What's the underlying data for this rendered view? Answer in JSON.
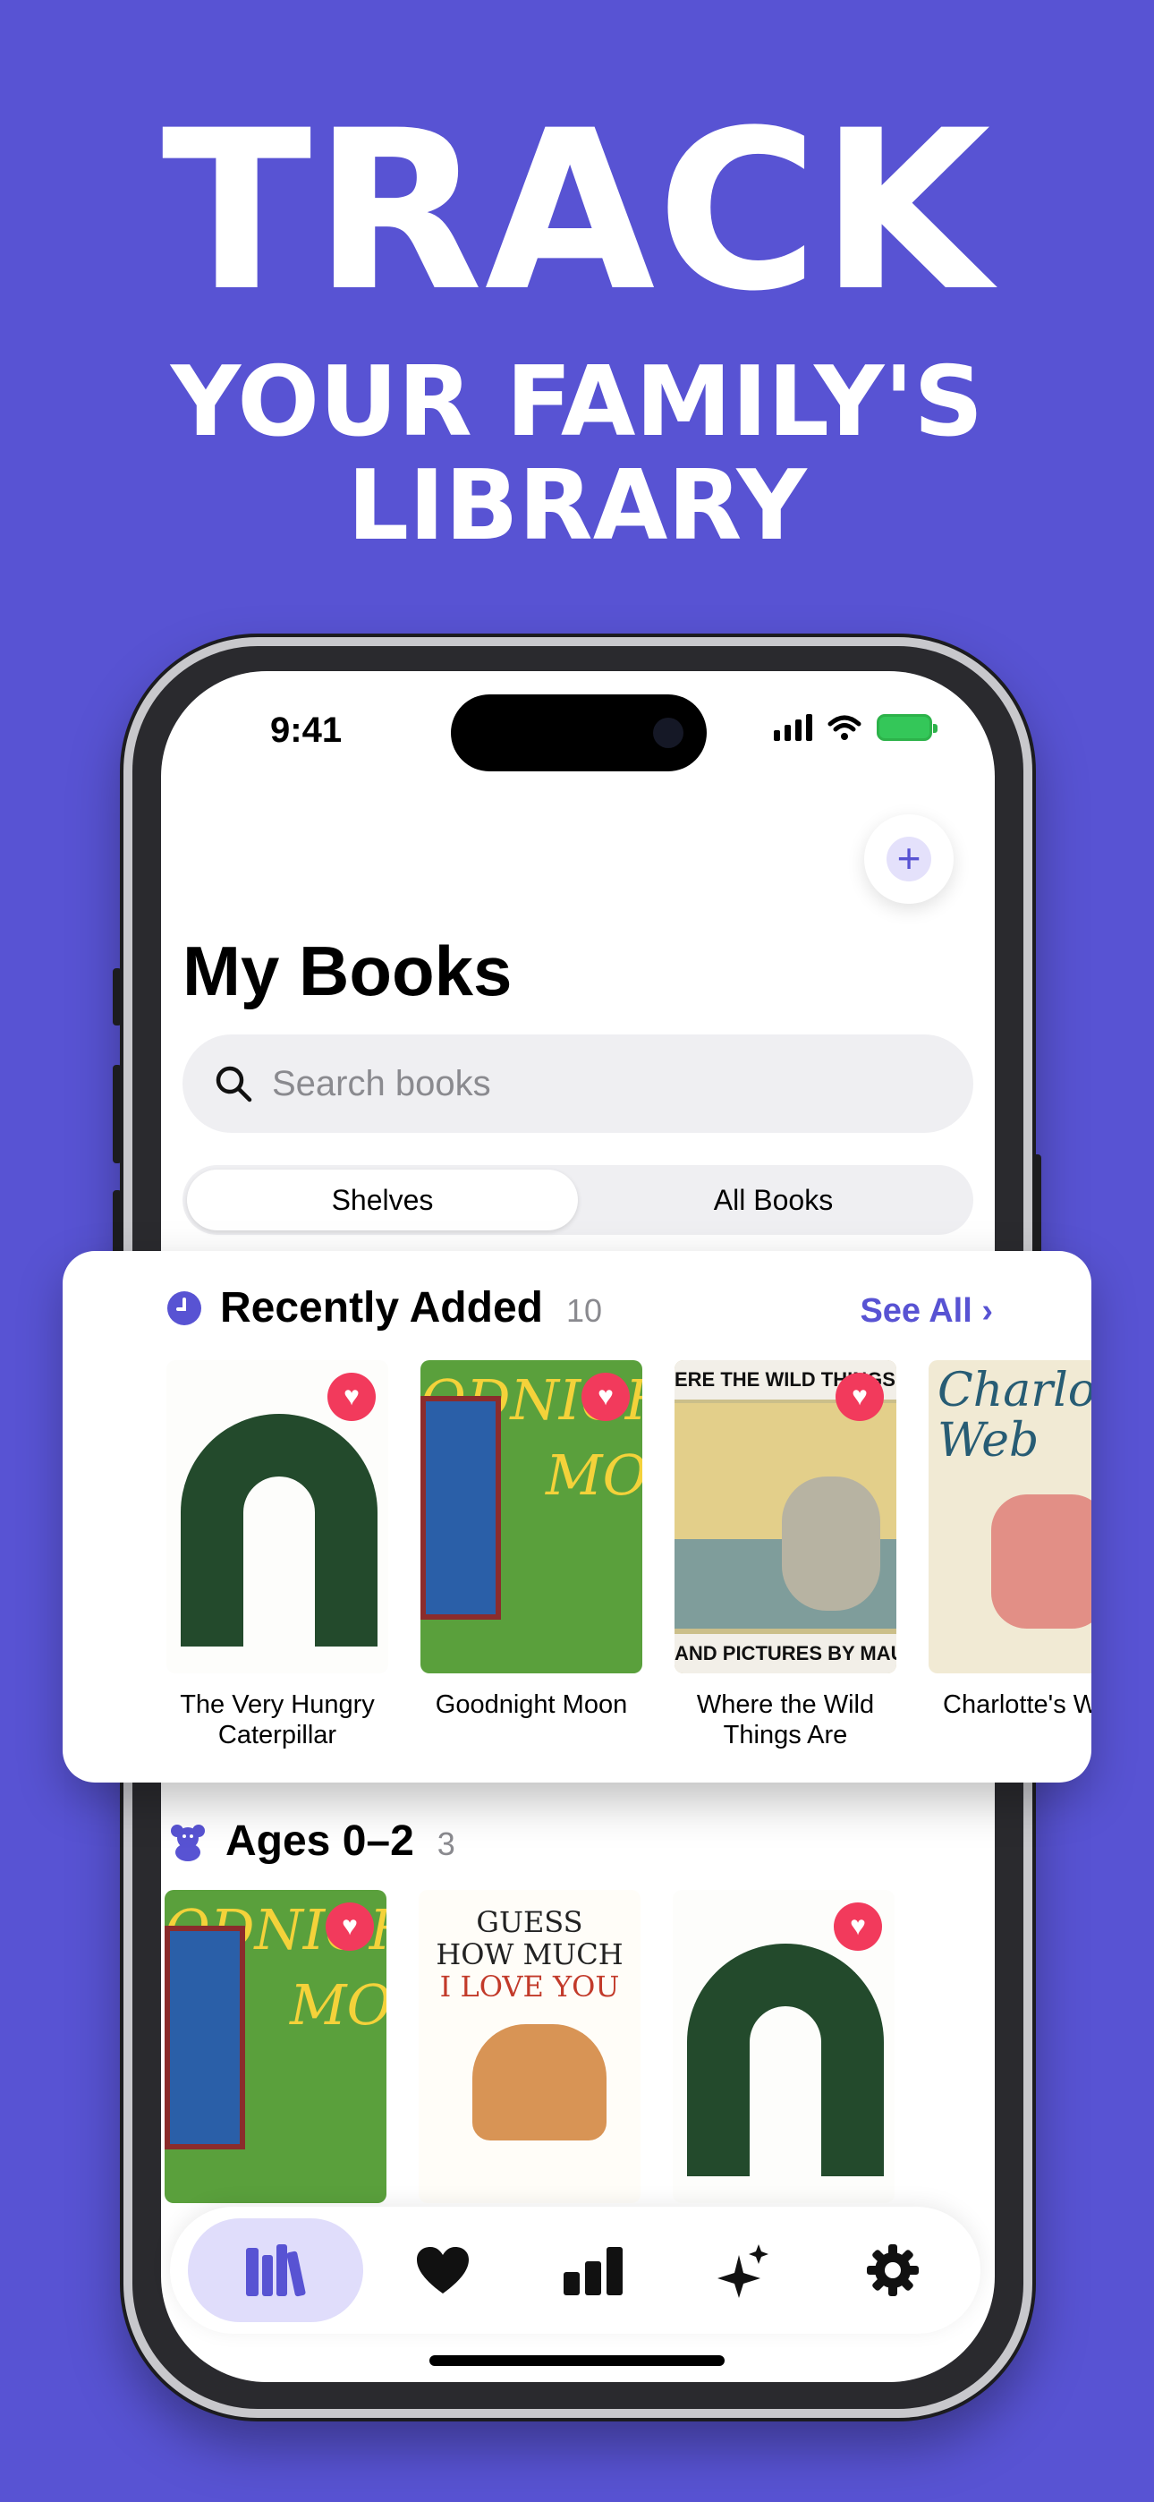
{
  "headline": {
    "line1": "TRACK",
    "line2": "YOUR FAMILY'S",
    "line3": "LIBRARY"
  },
  "status_bar": {
    "time": "9:41"
  },
  "screen": {
    "title": "My Books",
    "search_placeholder": "Search books",
    "segments": [
      "Shelves",
      "All Books"
    ],
    "selected_segment": "Shelves"
  },
  "recently_added": {
    "title": "Recently Added",
    "count": "10",
    "see_all": "See All",
    "books": [
      {
        "title_line1": "The Very Hungry",
        "title_line2": "Caterpillar",
        "favorite": true
      },
      {
        "title_line1": "Goodnight Moon",
        "title_line2": "",
        "favorite": true
      },
      {
        "title_line1": "Where the Wild",
        "title_line2": "Things Are",
        "favorite": true
      },
      {
        "title_line1": "Charlotte's W",
        "title_line2": "",
        "favorite": false
      }
    ]
  },
  "cover_text": {
    "moon_top": "ODNIGHT",
    "moon_mid": "MOO",
    "wild_top": "ERE THE WILD THINGS A",
    "wild_bottom": "AND PICTURES BY MAURICE SE",
    "charlotte": "Charlotte's Web",
    "guess_1": "GUESS",
    "guess_2": "HOW MUCH",
    "guess_3": "I LOVE YOU"
  },
  "ages_section": {
    "title": "Ages 0–2",
    "count": "3"
  },
  "tabs": [
    {
      "icon": "library-icon",
      "selected": true
    },
    {
      "icon": "heart-icon",
      "selected": false
    },
    {
      "icon": "stats-icon",
      "selected": false
    },
    {
      "icon": "sparkles-icon",
      "selected": false
    },
    {
      "icon": "gear-icon",
      "selected": false
    }
  ],
  "colors": {
    "background": "#5853d3",
    "accent": "#5853d3",
    "favorite": "#f23a5c"
  }
}
